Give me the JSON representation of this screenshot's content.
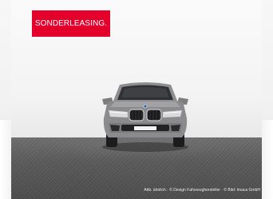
{
  "promo_badge": {
    "text": "SONDERLEASING."
  },
  "image_caption": {
    "text": "Abb. ähnlich · © Design Fahrzeughersteller · © Bild: Imaca GmbH"
  },
  "colors": {
    "badge_red": "#e4002b",
    "car_body": "#8a8a8c",
    "floor": "#555555"
  }
}
